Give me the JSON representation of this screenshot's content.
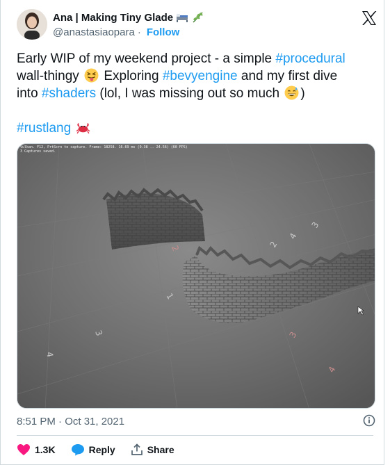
{
  "author": {
    "display_name": "Ana | Making Tiny Glade",
    "handle": "@anastasiaopara",
    "separator": "·",
    "follow_label": "Follow"
  },
  "tweet": {
    "line1_a": "Early WIP of my weekend project - a simple ",
    "tag_procedural": "#procedural",
    "line2_a": "wall-thingy ",
    "line2_b": " Exploring  ",
    "tag_bevy": "#bevyengine",
    "line2_c": " and my first dive",
    "line3_a": "into ",
    "tag_shaders": "#shaders",
    "line3_b": " (lol, I was missing out so much ",
    "line3_c": ")",
    "tag_rust": "#rustlang"
  },
  "media": {
    "console_line_1": "Vulkan. F12, PrtScrn to capture. Frame: 18258. 16.69 ms (9.38 .. 24.56) (60 FPS)",
    "console_line_2": "3 Captures saved.",
    "floor_numbers": [
      "2",
      "1",
      "3",
      "4",
      "3",
      "4",
      "3",
      "4",
      "2"
    ]
  },
  "meta": {
    "timestamp": "8:51 PM · Oct 31, 2021"
  },
  "actions": {
    "likes": "1.3K",
    "reply_label": "Reply",
    "share_label": "Share"
  },
  "colors": {
    "link": "#1d9bf0",
    "like": "#f91880",
    "secondary_text": "#536471"
  }
}
